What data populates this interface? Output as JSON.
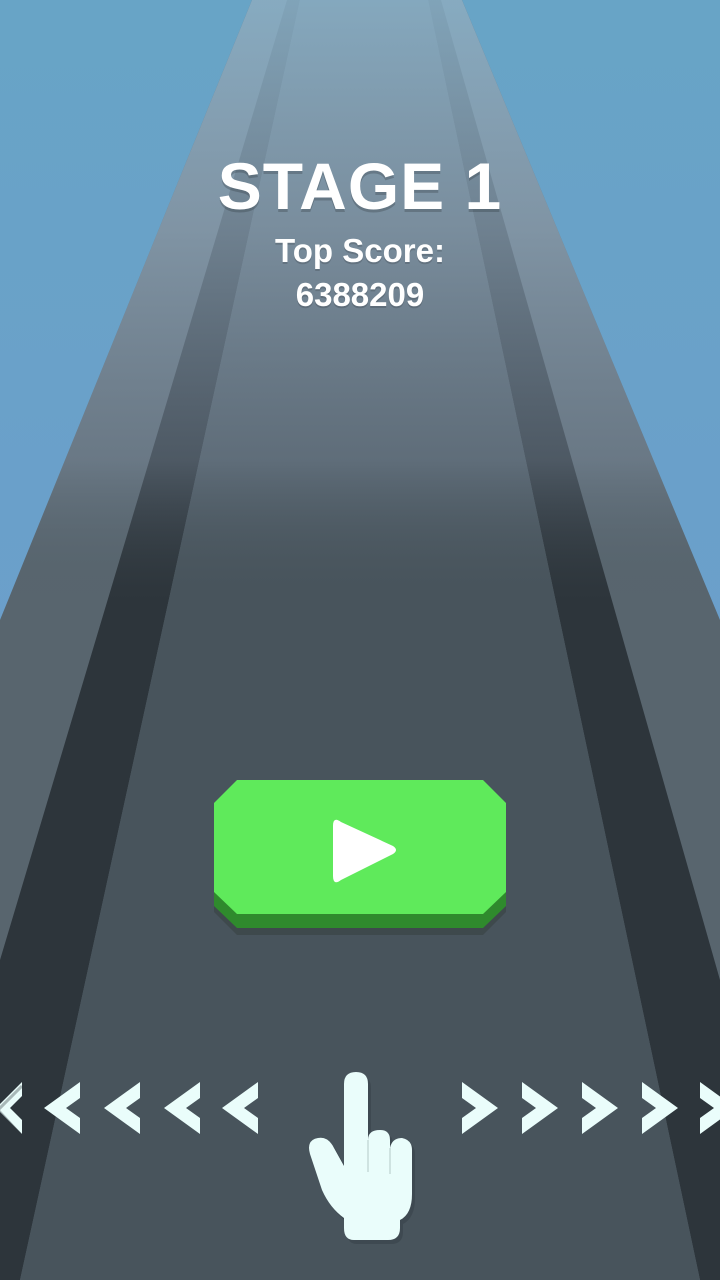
{
  "stage": {
    "title": "STAGE 1"
  },
  "score": {
    "label": "Top Score:",
    "value": "6388209"
  },
  "play_button": {
    "icon": "play-icon"
  },
  "swipe_hint": {
    "icon": "pointing-hand-icon",
    "left_arrow_icon": "chevron-left-icon",
    "right_arrow_icon": "chevron-right-icon"
  },
  "colors": {
    "sky_top": "#6aa3c6",
    "sky_bottom": "#6e93cd",
    "road": "#48545c",
    "road_edge": "#2d353b",
    "button_green": "#5fea5b",
    "button_shadow": "#2f8a2d",
    "hint_white": "#eafdfb"
  }
}
